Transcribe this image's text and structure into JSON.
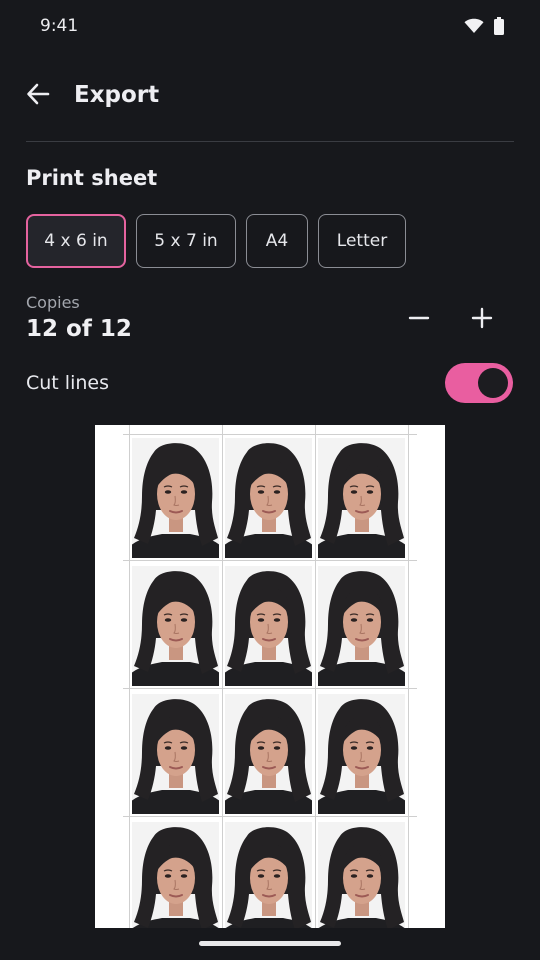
{
  "status_bar": {
    "time": "9:41",
    "icons": [
      "wifi-icon",
      "battery-icon"
    ]
  },
  "app_bar": {
    "title": "Export",
    "back_icon": "arrow-back-icon"
  },
  "print_sheet": {
    "title": "Print sheet",
    "sizes": [
      {
        "label": "4 x 6 in",
        "selected": true
      },
      {
        "label": "5 x 7 in",
        "selected": false
      },
      {
        "label": "A4",
        "selected": false
      },
      {
        "label": "Letter",
        "selected": false
      }
    ]
  },
  "copies": {
    "label": "Copies",
    "value": "12 of 12",
    "decrement_icon": "minus-icon",
    "increment_icon": "plus-icon"
  },
  "cut_lines": {
    "label": "Cut lines",
    "enabled": true
  },
  "preview": {
    "photo_count": 12
  },
  "colors": {
    "accent": "#e95ea0",
    "background": "#17181c",
    "chip_border": "#8b8d94"
  }
}
